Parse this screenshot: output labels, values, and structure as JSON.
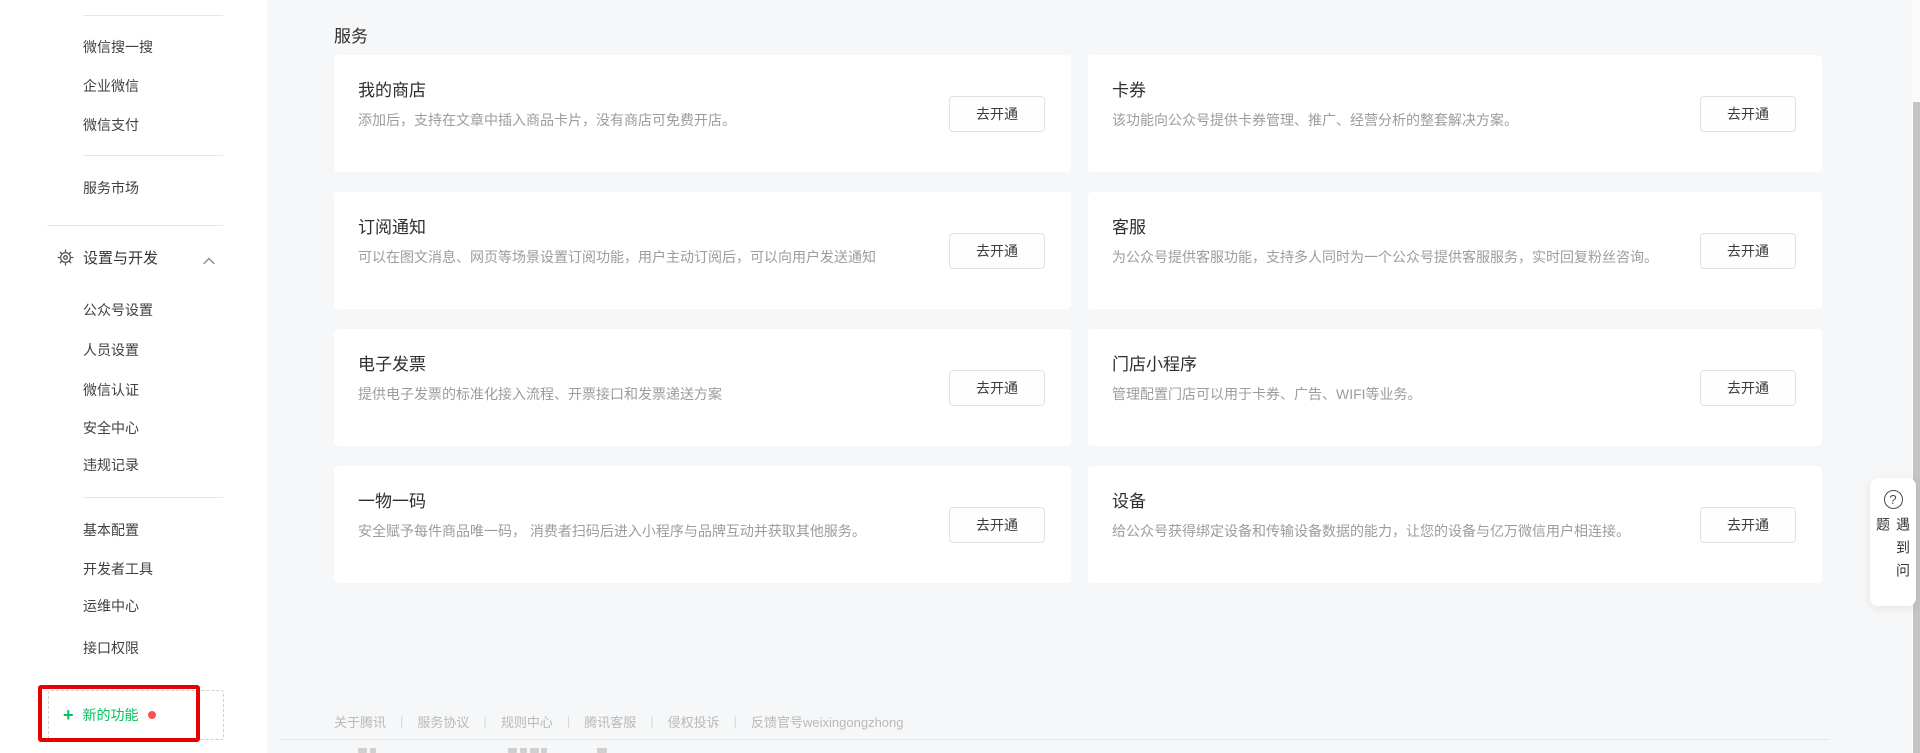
{
  "page": {
    "title": "服务"
  },
  "sidebar": {
    "top_items": [
      {
        "label": "微信搜一搜"
      },
      {
        "label": "企业微信"
      },
      {
        "label": "微信支付"
      }
    ],
    "market_item": {
      "label": "服务市场"
    },
    "settings": {
      "label": "设置与开发",
      "children": [
        {
          "label": "公众号设置"
        },
        {
          "label": "人员设置"
        },
        {
          "label": "微信认证"
        },
        {
          "label": "安全中心"
        },
        {
          "label": "违规记录"
        }
      ],
      "dev_children": [
        {
          "label": "基本配置"
        },
        {
          "label": "开发者工具"
        },
        {
          "label": "运维中心"
        },
        {
          "label": "接口权限"
        }
      ]
    },
    "new_feature": {
      "plus": "+",
      "label": "新的功能"
    }
  },
  "cards": [
    {
      "title": "我的商店",
      "desc": "添加后，支持在文章中插入商品卡片，没有商店可免费开店。",
      "button": "去开通"
    },
    {
      "title": "卡券",
      "desc": "该功能向公众号提供卡券管理、推广、经营分析的整套解决方案。",
      "button": "去开通"
    },
    {
      "title": "订阅通知",
      "desc": "可以在图文消息、网页等场景设置订阅功能，用户主动订阅后，可以向用户发送通知",
      "button": "去开通"
    },
    {
      "title": "客服",
      "desc": "为公众号提供客服功能，支持多人同时为一个公众号提供客服服务，实时回复粉丝咨询。",
      "button": "去开通"
    },
    {
      "title": "电子发票",
      "desc": "提供电子发票的标准化接入流程、开票接口和发票递送方案",
      "button": "去开通"
    },
    {
      "title": "门店小程序",
      "desc": "管理配置门店可以用于卡券、广告、WIFI等业务。",
      "button": "去开通"
    },
    {
      "title": "一物一码",
      "desc": "安全赋予每件商品唯一码， 消费者扫码后进入小程序与品牌互动并获取其他服务。",
      "button": "去开通"
    },
    {
      "title": "设备",
      "desc": "给公众号获得绑定设备和传输设备数据的能力，让您的设备与亿万微信用户相连接。",
      "button": "去开通"
    }
  ],
  "footer": {
    "separator": "|",
    "links": [
      "关于腾讯",
      "服务协议",
      "规则中心",
      "腾讯客服",
      "侵权投诉",
      "反馈官号weixingongzhong"
    ]
  },
  "help_widget": {
    "icon": "?",
    "label": "遇到问题"
  },
  "colors": {
    "accent_green": "#07c160",
    "highlight_red": "#e60000",
    "badge_red": "#fa5151",
    "main_background": "#f6f7f8"
  }
}
